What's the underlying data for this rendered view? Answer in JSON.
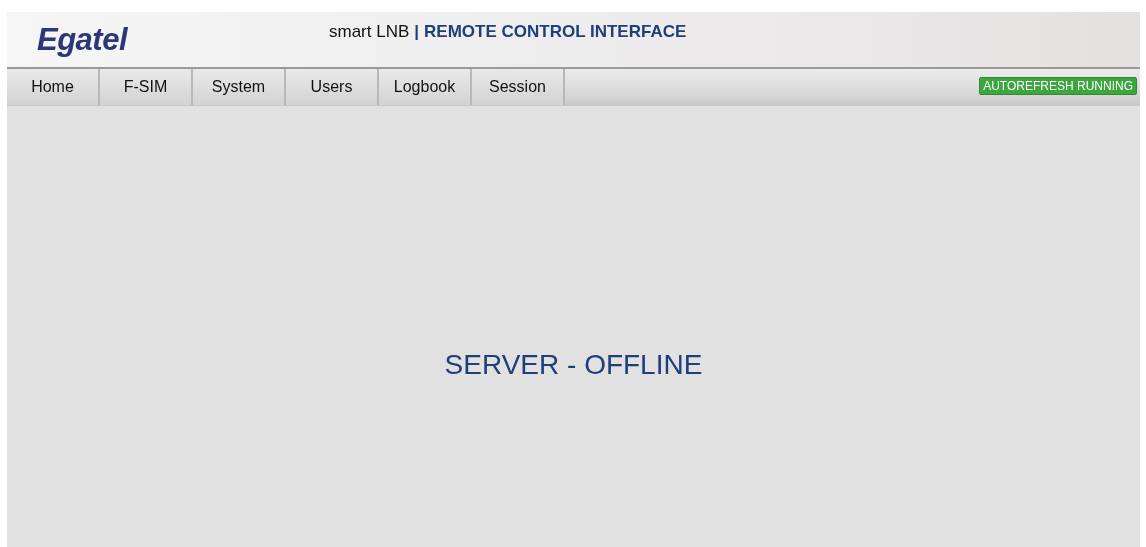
{
  "header": {
    "logo": "Egatel",
    "product": "smart LNB",
    "separator": "|",
    "subtitle": "REMOTE CONTROL INTERFACE"
  },
  "nav": {
    "items": [
      {
        "label": "Home"
      },
      {
        "label": "F-SIM"
      },
      {
        "label": "System"
      },
      {
        "label": "Users"
      },
      {
        "label": "Logbook"
      },
      {
        "label": "Session"
      }
    ],
    "status_badge": "AUTOREFRESH RUNNING"
  },
  "main": {
    "message": "SERVER - OFFLINE"
  }
}
